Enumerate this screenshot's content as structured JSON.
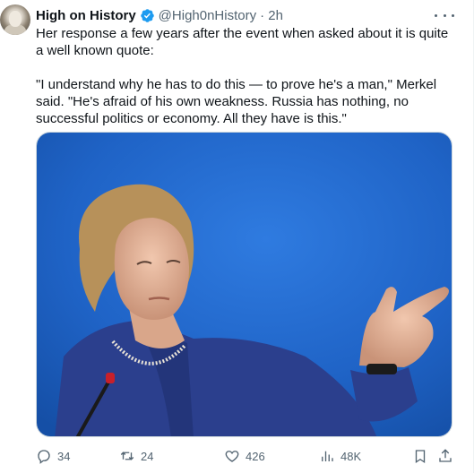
{
  "author": {
    "name": "High on History",
    "handle": "@High0nHistory",
    "time": "· 2h"
  },
  "tweet": {
    "line1": "Her response a few years after the event when asked about it is quite a well known quote:",
    "line2": "\"I understand why he has to do this — to prove he's a man,\" Merkel said. \"He's afraid of his own weakness. Russia has nothing, no successful politics or economy. All they have is this.\""
  },
  "actions": {
    "replies": "34",
    "retweets": "24",
    "likes": "426",
    "views": "48K"
  },
  "colors": {
    "verified": "#1d9bf0",
    "muted": "#536471",
    "photo_background": "#1f63c6",
    "jacket": "#2b3f8d"
  },
  "icons": [
    "more-icon",
    "verified-badge-icon",
    "reply-icon",
    "retweet-icon",
    "like-icon",
    "views-icon",
    "bookmark-icon",
    "share-icon"
  ]
}
